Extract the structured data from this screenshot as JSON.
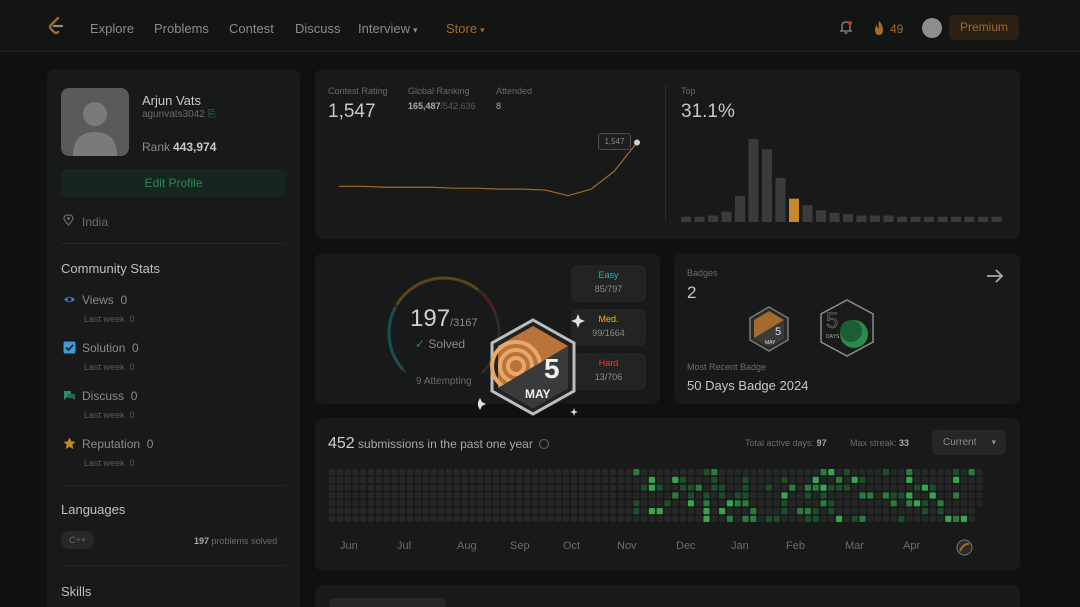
{
  "nav": {
    "items": [
      "Explore",
      "Problems",
      "Contest",
      "Discuss",
      "Interview",
      "Store"
    ],
    "streak": "49",
    "premium": "Premium"
  },
  "profile": {
    "name": "Arjun Vats",
    "username": "agunvats3042",
    "rank_label": "Rank",
    "rank": "443,974",
    "edit": "Edit Profile",
    "location": "India"
  },
  "community": {
    "title": "Community Stats",
    "items": [
      {
        "label": "Views",
        "value": "0",
        "sub_label": "Last week",
        "sub_value": "0",
        "icon": "eye-icon",
        "color": "#3a7bd5"
      },
      {
        "label": "Solution",
        "value": "0",
        "sub_label": "Last week",
        "sub_value": "0",
        "icon": "solution-icon",
        "color": "#3a9bd5"
      },
      {
        "label": "Discuss",
        "value": "0",
        "sub_label": "Last week",
        "sub_value": "0",
        "icon": "discuss-icon",
        "color": "#2b8a6e"
      },
      {
        "label": "Reputation",
        "value": "0",
        "sub_label": "Last week",
        "sub_value": "0",
        "icon": "star-icon",
        "color": "#c28a2a"
      }
    ]
  },
  "languages": {
    "title": "Languages",
    "tag": "C++",
    "solved_count": "197",
    "solved_suffix": "problems solved"
  },
  "skills": {
    "title": "Skills"
  },
  "contest": {
    "rating_label": "Contest Rating",
    "rating": "1,547",
    "global_label": "Global Ranking",
    "global_rank": "165,487",
    "global_total": "/542,636",
    "attended_label": "Attended",
    "attended": "8",
    "tooltip": "1,547",
    "top_label": "Top",
    "top_value": "31.1%",
    "rating_history": [
      1500,
      1500,
      1499,
      1499,
      1499,
      1498,
      1498,
      1497,
      1497,
      1496,
      1490,
      1497,
      1516,
      1547
    ],
    "distribution": [
      4,
      4,
      5,
      8,
      20,
      64,
      56,
      34,
      18,
      13,
      9,
      7,
      6,
      5,
      5,
      5,
      4,
      4,
      4,
      4,
      4,
      4,
      4,
      4
    ],
    "highlight_index": 8
  },
  "solved": {
    "count": "197",
    "total": "/3167",
    "label": "Solved",
    "attempting": "9 Attempting",
    "easy_label": "Easy",
    "easy": "85/797",
    "medium_label": "Med.",
    "medium": "99/1664",
    "hard_label": "Hard",
    "hard": "13/706",
    "colors": {
      "easy": "#1cbaba",
      "medium": "#ffb700",
      "hard": "#f63737"
    }
  },
  "badges": {
    "title": "Badges",
    "count": "2",
    "recent_label": "Most Recent Badge",
    "recent": "50 Days Badge 2024",
    "badge1_day": "5",
    "badge1_month": "MAY",
    "badge2_label": "DAYS"
  },
  "popup": {
    "day": "5",
    "month": "MAY"
  },
  "submissions": {
    "count": "452",
    "text": "submissions in the past one year",
    "active_label": "Total active days:",
    "active": "97",
    "streak_label": "Max streak:",
    "streak": "33",
    "dropdown": "Current",
    "months": [
      "Jun",
      "Jul",
      "Aug",
      "Sep",
      "Oct",
      "Nov",
      "Dec",
      "Jan",
      "Feb",
      "Mar",
      "Apr"
    ]
  }
}
